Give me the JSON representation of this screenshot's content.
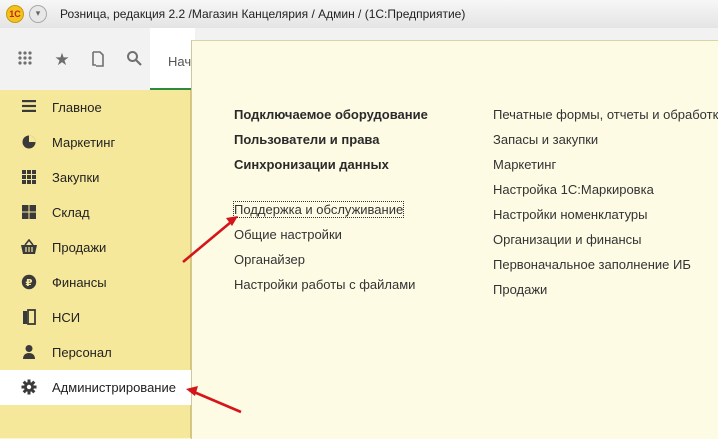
{
  "window": {
    "logo_text": "1С",
    "menu_glyph": "▾",
    "title": "Розница, редакция 2.2 /Магазин Канцелярия / Админ /  (1С:Предприятие)"
  },
  "toolbar": {
    "icons": [
      "apps-grid-icon",
      "star-icon",
      "history-icon",
      "search-icon"
    ],
    "tab_label": "Нач"
  },
  "sidebar": {
    "items": [
      {
        "label": "Главное",
        "icon": "list-icon"
      },
      {
        "label": "Маркетинг",
        "icon": "pie-chart-icon"
      },
      {
        "label": "Закупки",
        "icon": "grid-table-icon"
      },
      {
        "label": "Склад",
        "icon": "warehouse-icon"
      },
      {
        "label": "Продажи",
        "icon": "basket-icon"
      },
      {
        "label": "Финансы",
        "icon": "ruble-icon"
      },
      {
        "label": "НСИ",
        "icon": "reference-icon"
      },
      {
        "label": "Персонал",
        "icon": "person-icon"
      },
      {
        "label": "Администрирование",
        "icon": "gear-icon",
        "active": true
      }
    ]
  },
  "panel": {
    "bold_links": [
      "Подключаемое оборудование",
      "Пользователи и права",
      "Синхронизации данных"
    ],
    "links": [
      "Поддержка и обслуживание",
      "Общие настройки",
      "Органайзер",
      "Настройки работы с файлами"
    ],
    "right_links": [
      "Печатные формы, отчеты и обработки",
      "Запасы и закупки",
      "Маркетинг",
      "Настройка 1С:Маркировка",
      "Настройки номенклатуры",
      "Организации и финансы",
      "Первоначальное заполнение ИБ",
      "Продажи"
    ]
  },
  "colors": {
    "sidebar_bg": "#f6e89a",
    "panel_bg": "#fdfbe4",
    "active_tab_underline": "#2c8b3c",
    "annotation_arrow": "#d4161c"
  }
}
